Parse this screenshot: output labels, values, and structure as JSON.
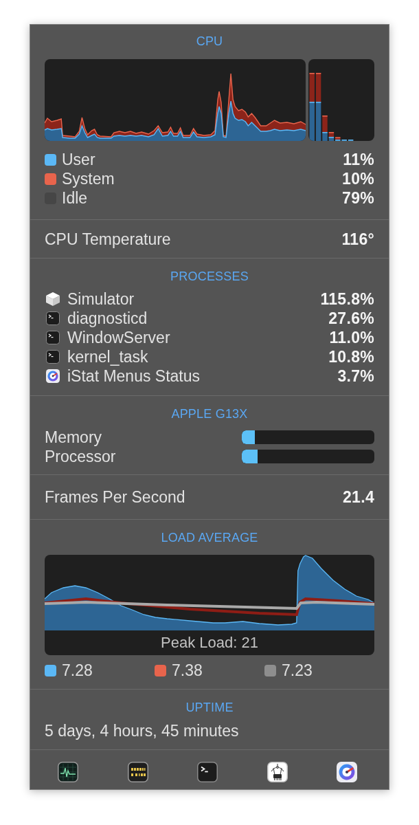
{
  "cpu": {
    "title": "CPU",
    "legend": [
      {
        "label": "User",
        "value": "11%",
        "color": "#5bb8f6"
      },
      {
        "label": "System",
        "value": "10%",
        "color": "#e8644c"
      },
      {
        "label": "Idle",
        "value": "79%",
        "color": "#464646"
      }
    ]
  },
  "cpu_temperature": {
    "label": "CPU Temperature",
    "value": "116°"
  },
  "processes": {
    "title": "PROCESSES",
    "rows": [
      {
        "kind": "simulator",
        "name": "Simulator",
        "value": "115.8%"
      },
      {
        "kind": "executable",
        "name": "diagnosticd",
        "value": "27.6%"
      },
      {
        "kind": "executable",
        "name": "WindowServer",
        "value": "11.0%"
      },
      {
        "kind": "executable",
        "name": "kernel_task",
        "value": "10.8%"
      },
      {
        "kind": "istat",
        "name": "iStat Menus Status",
        "value": "3.7%"
      }
    ]
  },
  "gpu": {
    "title": "APPLE G13X",
    "meters": [
      {
        "label": "Memory",
        "level": 0.1
      },
      {
        "label": "Processor",
        "level": 0.12
      }
    ]
  },
  "frames_per_second": {
    "label": "Frames Per Second",
    "value": "21.4"
  },
  "load_average": {
    "title": "LOAD AVERAGE",
    "peak": "Peak Load: 21",
    "legend": [
      {
        "value": "7.28",
        "color": "#5bb8f6"
      },
      {
        "value": "7.38",
        "color": "#e8644c"
      },
      {
        "value": "7.23",
        "color": "#8e8e8e"
      }
    ]
  },
  "uptime": {
    "title": "UPTIME",
    "text": "5 days, 4 hours, 45 minutes"
  }
}
